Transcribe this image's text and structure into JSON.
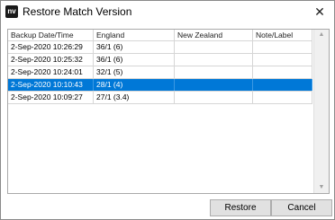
{
  "window": {
    "title": "Restore Match Version",
    "app_icon_text": "nv",
    "close_glyph": "✕"
  },
  "grid": {
    "columns": [
      "Backup Date/Time",
      "England",
      "New Zealand",
      "Note/Label"
    ],
    "rows": [
      {
        "date": "2-Sep-2020 10:26:29",
        "england": "36/1 (6)",
        "nz": "",
        "note": "",
        "selected": false
      },
      {
        "date": "2-Sep-2020 10:25:32",
        "england": "36/1 (6)",
        "nz": "",
        "note": "",
        "selected": false
      },
      {
        "date": "2-Sep-2020 10:24:01",
        "england": "32/1 (5)",
        "nz": "",
        "note": "",
        "selected": false
      },
      {
        "date": "2-Sep-2020 10:10:43",
        "england": "28/1 (4)",
        "nz": "",
        "note": "",
        "selected": true
      },
      {
        "date": "2-Sep-2020 10:09:27",
        "england": "27/1 (3.4)",
        "nz": "",
        "note": "",
        "selected": false
      }
    ]
  },
  "buttons": {
    "restore": "Restore",
    "cancel": "Cancel"
  },
  "colors": {
    "selection": "#0078d7"
  }
}
